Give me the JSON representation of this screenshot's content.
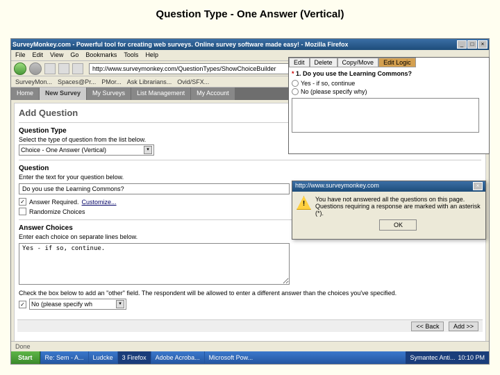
{
  "slide": {
    "title": "Question Type - One Answer (Vertical)"
  },
  "browser": {
    "title": "SurveyMonkey.com - Powerful tool for creating web surveys. Online survey software made easy! - Mozilla Firefox",
    "menubar": [
      "File",
      "Edit",
      "View",
      "Go",
      "Bookmarks",
      "Tools",
      "Help"
    ],
    "url": "http://www.surveymonkey.com/QuestionTypes/ShowChoiceBuilder",
    "bookmarks": [
      "SurveyMon...",
      "Spaces@Pr...",
      "PMor...",
      "Ask Librarians...",
      "Ovid/SFX..."
    ],
    "tabs": [
      "Home",
      "New Survey",
      "My Surveys",
      "List Management",
      "My Account"
    ],
    "done": "Done"
  },
  "form": {
    "heading": "Add Question",
    "qt_label": "Question Type",
    "qt_desc": "Select the type of question from the list below.",
    "qt_dropdown": "Choice - One Answer (Vertical)",
    "q_label": "Question",
    "q_desc": "Enter the text for your question below.",
    "q_text": "Do you use the Learning Commons?",
    "answer_required": "Answer Required.",
    "customize": "Customize...",
    "randomize": "Randomize Choices",
    "choices_label": "Answer Choices",
    "choices_desc": "Enter each choice on separate lines below.",
    "choices_text": "Yes - if so, continue.",
    "other_hint": "Check the box below to add an \"other\" field. The respondent will be allowed to enter a different answer than the choices you've specified.",
    "other_field": "No (please specify wh",
    "back_btn": "<< Back",
    "add_btn": "Add >>"
  },
  "preview": {
    "tabs": [
      "Edit",
      "Delete",
      "Copy/Move",
      "Edit Logic"
    ],
    "question": "1. Do you use the Learning Commons?",
    "opt1": "Yes - if so, continue",
    "opt2": "No (please specify why)"
  },
  "alert": {
    "title": "http://www.surveymonkey.com",
    "line1": "You have not answered all the questions on this page.",
    "line2": "Questions requiring a response are marked with an asterisk (*).",
    "ok": "OK"
  },
  "taskbar": {
    "start": "Start",
    "items": [
      "Re: Sem - A...",
      "Ludcke",
      "3 Firefox",
      "Adobe Acroba...",
      "Microsoft Pow..."
    ],
    "tray_app": "Symantec Anti...",
    "clock": "10:10 PM"
  }
}
